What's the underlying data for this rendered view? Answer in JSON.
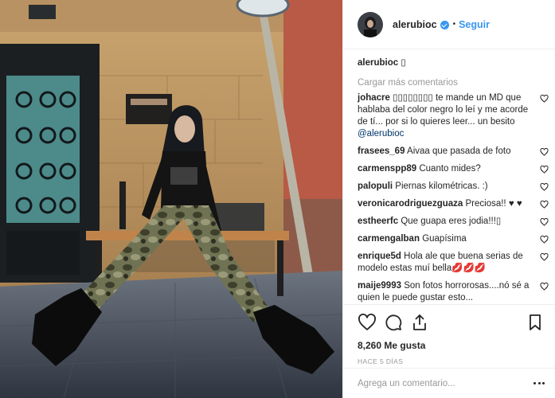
{
  "post": {
    "username": "alerubioc",
    "verified": true,
    "follow_label": "Seguir",
    "separator": "•"
  },
  "caption": {
    "username": "alerubioc",
    "text": "▯"
  },
  "load_more_label": "Cargar más comentarios",
  "comments": [
    {
      "user": "johacre",
      "text": "▯▯▯▯▯▯▯▯ te mande un MD que hablaba del color negro lo leí y me acorde de tí... por si lo quieres leer... un besito",
      "mention": "@alerubioc"
    },
    {
      "user": "frasees_69",
      "text": "Aivaa que pasada de foto",
      "mention": ""
    },
    {
      "user": "carmenspp89",
      "text": "Cuanto mides?",
      "mention": ""
    },
    {
      "user": "palopuli",
      "text": "Piernas kilométricas. :)",
      "mention": ""
    },
    {
      "user": "veronicarodriguezguaza",
      "text": "Preciosa!! ♥ ♥",
      "mention": ""
    },
    {
      "user": "estheerfc",
      "text": "Que guapa eres jodia!!!▯",
      "mention": ""
    },
    {
      "user": "carmengalban",
      "text": "Guapísima",
      "mention": ""
    },
    {
      "user": "enrique5d",
      "text": "Hola ale que buena serias de modelo estas muí bella💋💋💋",
      "mention": ""
    },
    {
      "user": "maije9993",
      "text": "Son fotos horrorosas....nó sé a quien le puede gustar esto...",
      "mention": ""
    }
  ],
  "actions": {
    "likes": "8,260 Me gusta",
    "time": "Hace 5 días"
  },
  "comment_box": {
    "placeholder": "Agrega un comentario..."
  },
  "icons": {
    "avatar": "profile-avatar",
    "like": "heart-icon",
    "comment": "comment-bubble-icon",
    "share": "share-icon",
    "save": "bookmark-icon",
    "options": "more-options-icon"
  },
  "colors": {
    "accent": "#3897f0",
    "muted": "#999999",
    "text": "#262626",
    "border": "#efefef"
  }
}
